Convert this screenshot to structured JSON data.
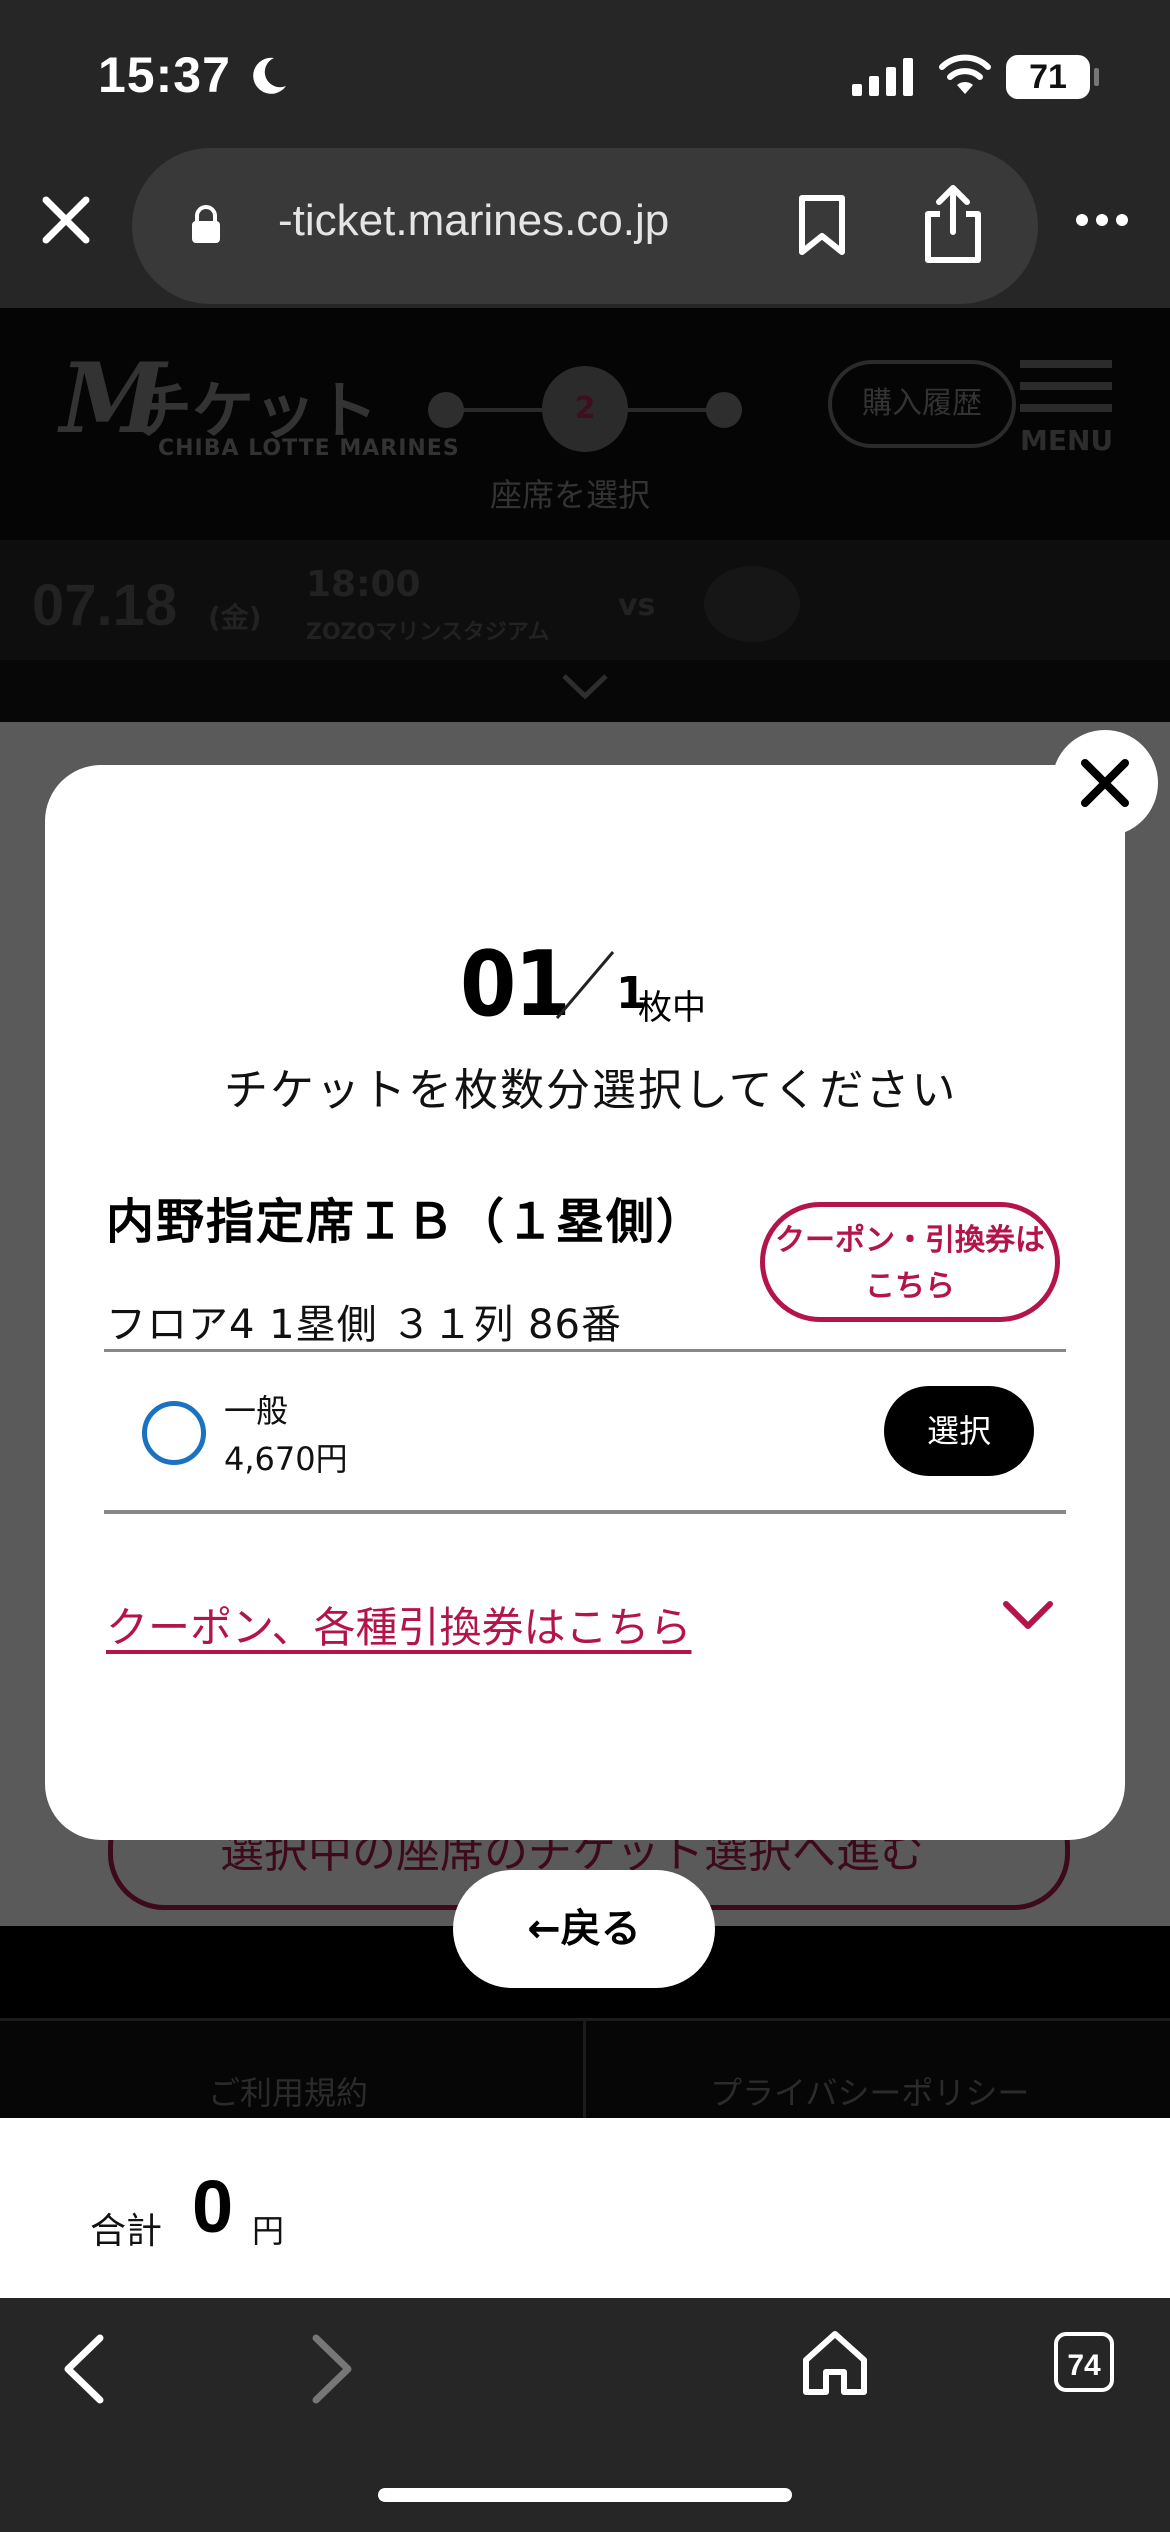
{
  "status_bar": {
    "time": "15:37",
    "battery": "71"
  },
  "browser": {
    "url": "-ticket.marines.co.jp",
    "tabs_count": "74"
  },
  "site_header": {
    "logo_text": "チケット",
    "logo_letter": "M",
    "logo_subtitle": "CHIBA LOTTE MARINES",
    "current_step": "2",
    "step_label": "座席を選択",
    "history_button": "購入履歴",
    "menu_label": "MENU"
  },
  "game": {
    "date": "07.18",
    "weekday": "(金)",
    "time": "18:00",
    "venue": "ZOZOマリンスタジアム",
    "vs": "vs"
  },
  "background_button": "選択中の座席のチケット選択へ進む",
  "footer": {
    "terms": "ご利用規約",
    "privacy": "プライバシーポリシー"
  },
  "total": {
    "label": "合計",
    "value": "0",
    "unit": "円"
  },
  "modal": {
    "current_count": "01",
    "total_count": "1",
    "count_unit": "枚中",
    "instruction": "チケットを枚数分選択してください",
    "seat_type": "内野指定席ＩＢ（１塁側）",
    "coupon_button": "クーポン・引換券はこちら",
    "seat_location": "フロア4  1塁側  ３１列  86番",
    "fares": [
      {
        "name": "一般",
        "price": "4,670円",
        "button": "選択"
      }
    ],
    "coupon_link": "クーポン、各種引換券はこちら"
  },
  "back_button": "←戻る",
  "colors": {
    "accent": "#b3154a",
    "radio": "#1a72c0"
  }
}
